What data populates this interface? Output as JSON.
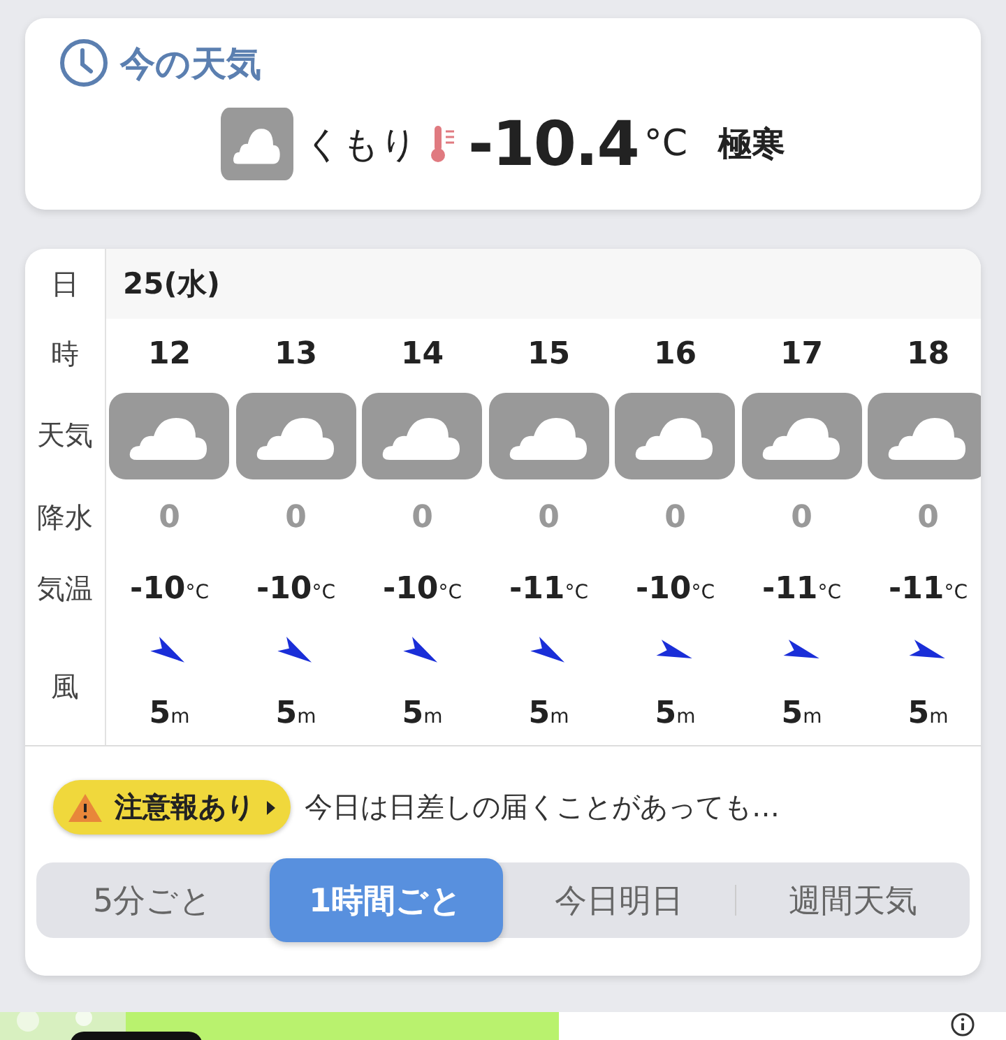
{
  "current": {
    "title": "今の天気",
    "icon": {
      "kind": "cloudy"
    },
    "condition": "くもり",
    "temperature": "-10.4",
    "unit": "°C",
    "note": "極寒"
  },
  "forecast": {
    "labels": {
      "date": "日",
      "hour": "時",
      "weather": "天気",
      "rain": "降水",
      "temp": "気温",
      "wind": "風"
    },
    "date": "25(水)",
    "hours": [
      {
        "hour": "12",
        "icon": {
          "kind": "cloudy"
        },
        "rain": "0",
        "temp": "-10",
        "temp_unit": "°C",
        "arrow": {
          "kind": "steep"
        },
        "wind": "5",
        "wind_unit": "m"
      },
      {
        "hour": "13",
        "icon": {
          "kind": "cloudy"
        },
        "rain": "0",
        "temp": "-10",
        "temp_unit": "°C",
        "arrow": {
          "kind": "steep"
        },
        "wind": "5",
        "wind_unit": "m"
      },
      {
        "hour": "14",
        "icon": {
          "kind": "cloudy"
        },
        "rain": "0",
        "temp": "-10",
        "temp_unit": "°C",
        "arrow": {
          "kind": "steep"
        },
        "wind": "5",
        "wind_unit": "m"
      },
      {
        "hour": "15",
        "icon": {
          "kind": "cloudy"
        },
        "rain": "0",
        "temp": "-11",
        "temp_unit": "°C",
        "arrow": {
          "kind": "steep"
        },
        "wind": "5",
        "wind_unit": "m"
      },
      {
        "hour": "16",
        "icon": {
          "kind": "cloudy"
        },
        "rain": "0",
        "temp": "-10",
        "temp_unit": "°C",
        "arrow": {
          "kind": "shallow"
        },
        "wind": "5",
        "wind_unit": "m"
      },
      {
        "hour": "17",
        "icon": {
          "kind": "cloudy"
        },
        "rain": "0",
        "temp": "-11",
        "temp_unit": "°C",
        "arrow": {
          "kind": "shallow"
        },
        "wind": "5",
        "wind_unit": "m"
      },
      {
        "hour": "18",
        "icon": {
          "kind": "cloudy"
        },
        "rain": "0",
        "temp": "-11",
        "temp_unit": "°C",
        "arrow": {
          "kind": "shallow"
        },
        "wind": "5",
        "wind_unit": "m"
      }
    ]
  },
  "alert": {
    "badge": "注意報あり",
    "text": "今日は日差しの届くことがあっても…"
  },
  "tabs": [
    {
      "label": "5分ごと",
      "selected": false
    },
    {
      "label": "1時間ごと",
      "selected": true
    },
    {
      "label": "今日明日",
      "selected": false
    },
    {
      "label": "週間天気",
      "selected": false
    }
  ]
}
